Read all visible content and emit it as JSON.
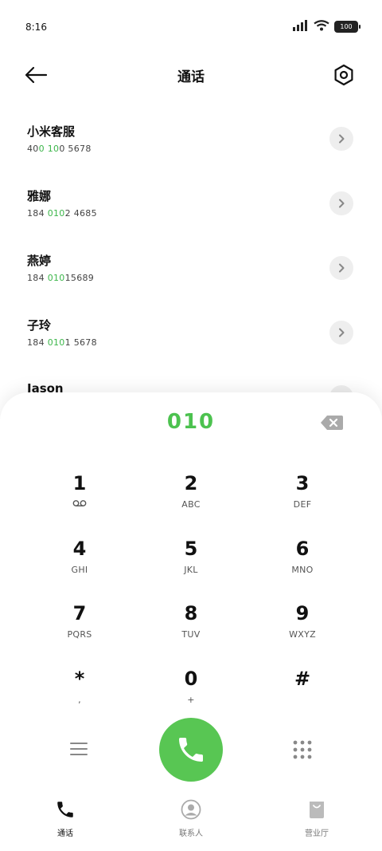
{
  "status_bar": {
    "time": "8:16",
    "battery": "100",
    "signal_icon": "signal-icon",
    "wifi_icon": "wifi-icon"
  },
  "header": {
    "title": "通话",
    "back_icon": "arrow-left-icon",
    "settings_icon": "settings-hexagon-icon"
  },
  "contacts": [
    {
      "name": "小米客服",
      "number_parts": [
        "40",
        "0",
        " ",
        "10",
        "0 5678"
      ]
    },
    {
      "name": "雅娜",
      "number_parts": [
        "184 ",
        "010",
        "",
        "",
        "2 4685"
      ]
    },
    {
      "name": "燕婷",
      "number_parts": [
        "184 ",
        "010",
        "",
        "",
        "15689"
      ]
    },
    {
      "name": "子玲",
      "number_parts": [
        "184 ",
        "010",
        "",
        "",
        "1 5678"
      ]
    },
    {
      "name": "Jason",
      "number_parts": [
        "",
        "",
        "",
        "",
        ""
      ]
    }
  ],
  "dialpad": {
    "input": "010",
    "keys": [
      {
        "digit": "1",
        "letters": ""
      },
      {
        "digit": "2",
        "letters": "ABC"
      },
      {
        "digit": "3",
        "letters": "DEF"
      },
      {
        "digit": "4",
        "letters": "GHI"
      },
      {
        "digit": "5",
        "letters": "JKL"
      },
      {
        "digit": "6",
        "letters": "MNO"
      },
      {
        "digit": "7",
        "letters": "PQRS"
      },
      {
        "digit": "8",
        "letters": "TUV"
      },
      {
        "digit": "9",
        "letters": "WXYZ"
      },
      {
        "digit": "*",
        "letters": ","
      },
      {
        "digit": "0",
        "letters": "+"
      },
      {
        "digit": "#",
        "letters": ""
      }
    ]
  },
  "tabs": [
    {
      "label": "通话",
      "icon": "phone-icon",
      "active": true
    },
    {
      "label": "联系人",
      "icon": "contacts-icon",
      "active": false
    },
    {
      "label": "营业厅",
      "icon": "store-bag-icon",
      "active": false
    }
  ],
  "colors": {
    "accent": "#4cc24f",
    "call_button": "#58c653"
  }
}
